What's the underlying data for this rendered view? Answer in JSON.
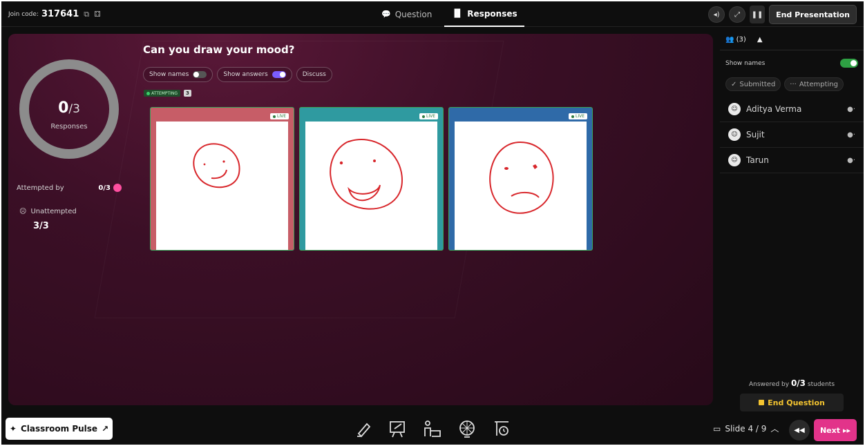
{
  "topbar": {
    "join_label": "Join code:",
    "join_code": "317641",
    "tabs": [
      {
        "label": "Question",
        "icon": "chat-icon"
      },
      {
        "label": "Responses",
        "icon": "bar-chart-icon"
      }
    ],
    "end_presentation": "End Presentation"
  },
  "summary": {
    "responses_count": "0",
    "responses_total": "/3",
    "responses_label": "Responses",
    "attempted_label": "Attempted by",
    "attempted_value": "0/3",
    "unattempted_label": "Unattempted",
    "unattempted_value": "3/3"
  },
  "question": {
    "title": "Can you draw your mood?",
    "show_names": "Show names",
    "show_answers": "Show answers",
    "discuss": "Discuss",
    "tag_attempting": "ATTEMPTING",
    "tag_count": "3"
  },
  "cards": [
    {
      "live": "LIVE",
      "color": "#c75d67"
    },
    {
      "live": "LIVE",
      "color": "#2f9aa0"
    },
    {
      "live": "LIVE",
      "color": "#2f6aa8"
    }
  ],
  "panel": {
    "count": "(3)",
    "show_names": "Show names",
    "filter_submitted": "Submitted",
    "filter_attempting": "Attempting",
    "students": [
      {
        "name": "Aditya Verma"
      },
      {
        "name": "Sujit"
      },
      {
        "name": "Tarun"
      }
    ],
    "answered_prefix": "Answered by",
    "answered_value": "0/3",
    "answered_suffix": "students",
    "end_question": "End Question"
  },
  "bottom": {
    "classroom_pulse": "Classroom Pulse",
    "slide_label": "Slide 4 / 9",
    "next": "Next"
  },
  "colors": {
    "accent_pink": "#e2338a",
    "toggle_purple": "#7b5cff",
    "toggle_green": "#2ea043",
    "end_question_yellow": "#f4c430",
    "drawing_red": "#d8262b"
  }
}
